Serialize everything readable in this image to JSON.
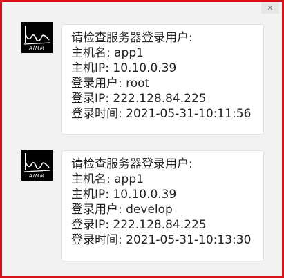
{
  "window": {
    "close_glyph": "×"
  },
  "messages": [
    {
      "avatar": {
        "icon": "aimm-logo-icon",
        "caption": "AIMM"
      },
      "lines": [
        "请检查服务器登录用户:",
        "主机名: app1",
        "主机IP: 10.10.0.39",
        "登录用户: root",
        "登录IP: 222.128.84.225",
        "登录时间: 2021-05-31-10:11:56"
      ]
    },
    {
      "avatar": {
        "icon": "aimm-logo-icon",
        "caption": "AIMM"
      },
      "lines": [
        "请检查服务器登录用户:",
        "主机名: app1",
        "主机IP: 10.10.0.39",
        "登录用户: develop",
        "登录IP: 222.128.84.225",
        "登录时间: 2021-05-31-10:13:30"
      ]
    }
  ],
  "colors": {
    "border": "#d8141b",
    "background": "#f2f2f2",
    "bubble": "#ffffff",
    "text": "#222222"
  }
}
